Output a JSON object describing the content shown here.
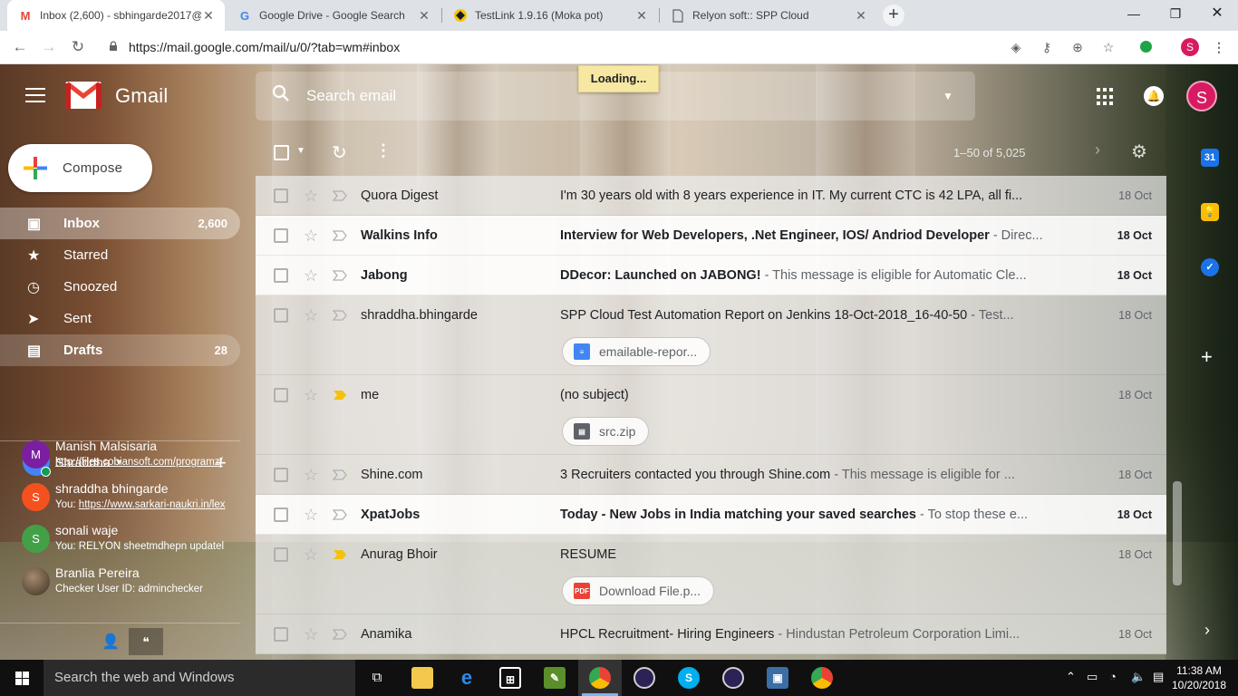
{
  "browser": {
    "tabs": [
      {
        "title": "Inbox (2,600) - sbhingarde2017@",
        "active": true,
        "icon": "gmail-icon"
      },
      {
        "title": "Google Drive - Google Search",
        "active": false,
        "icon": "google-icon"
      },
      {
        "title": "TestLink 1.9.16 (Moka pot)",
        "active": false,
        "icon": "testlink-icon"
      },
      {
        "title": "Relyon soft:: SPP Cloud",
        "active": false,
        "icon": "page-icon"
      }
    ],
    "url": "https://mail.google.com/mail/u/0/?tab=wm#inbox",
    "profile_initial": "S"
  },
  "gmail": {
    "app_name": "Gmail",
    "search_placeholder": "Search email",
    "loading_text": "Loading...",
    "account_initial": "S",
    "compose_label": "Compose",
    "nav": [
      {
        "label": "Inbox",
        "count": "2,600",
        "icon": "inbox-icon",
        "state": "active"
      },
      {
        "label": "Starred",
        "count": "",
        "icon": "star-icon",
        "state": "normal"
      },
      {
        "label": "Snoozed",
        "count": "",
        "icon": "clock-icon",
        "state": "normal"
      },
      {
        "label": "Sent",
        "count": "",
        "icon": "send-icon",
        "state": "normal"
      },
      {
        "label": "Drafts",
        "count": "28",
        "icon": "draft-icon",
        "state": "drafts"
      }
    ],
    "hangouts": {
      "user": "Shraddha",
      "contacts": [
        {
          "name": "Manish Malsisaria",
          "sub": "http://files.cobiansoft.com/programz/",
          "sub_prefix": "",
          "initial": "M",
          "color": "#7b1fa2"
        },
        {
          "name": "shraddha bhingarde",
          "sub": "https://www.sarkari-naukri.in/lex",
          "sub_prefix": "You: ",
          "initial": "S",
          "color": "#f4511e"
        },
        {
          "name": "sonali waje",
          "sub": "RELYON sheetmdhepn updatel",
          "sub_prefix": "You: ",
          "initial": "S",
          "color": "#43a047"
        },
        {
          "name": "Branlia Pereira",
          "sub": "Checker User ID: adminchecker",
          "sub_prefix": "",
          "initial": "",
          "color": "#5d4a3a"
        }
      ]
    },
    "list_toolbar": {
      "range": "1–50 of 5,025"
    },
    "emails": [
      {
        "sender": "Quora Digest",
        "subject": "I'm 30 years old with 8 years experience in IT. My current CTC is 42 LPA, all fi...",
        "snippet": "",
        "date": "18 Oct",
        "unread": false,
        "important": false,
        "attachment": ""
      },
      {
        "sender": "Walkins Info",
        "subject": "Interview for Web Developers, .Net Engineer, IOS/ Andriod Developer",
        "snippet": " - Direc...",
        "date": "18 Oct",
        "unread": true,
        "important": false,
        "attachment": ""
      },
      {
        "sender": "Jabong",
        "subject": "DDecor: Launched on JABONG!",
        "snippet": " - This message is eligible for Automatic Cle...",
        "date": "18 Oct",
        "unread": true,
        "important": false,
        "attachment": ""
      },
      {
        "sender": "shraddha.bhingarde",
        "subject": "SPP Cloud Test Automation Report on Jenkins 18-Oct-2018_16-40-50",
        "snippet": " - Test...",
        "date": "18 Oct",
        "unread": false,
        "important": false,
        "attachment": "emailable-repor...",
        "attachment_type": "doc"
      },
      {
        "sender": "me",
        "subject": "(no subject)",
        "snippet": "",
        "date": "18 Oct",
        "unread": false,
        "important": true,
        "attachment": "src.zip",
        "attachment_type": "zip"
      },
      {
        "sender": "Shine.com",
        "subject": "3 Recruiters contacted you through Shine.com",
        "snippet": " - This message is eligible for ...",
        "date": "18 Oct",
        "unread": false,
        "important": false,
        "attachment": ""
      },
      {
        "sender": "XpatJobs",
        "subject": "Today - New Jobs in India matching your saved searches",
        "snippet": " - To stop these e...",
        "date": "18 Oct",
        "unread": true,
        "important": false,
        "attachment": ""
      },
      {
        "sender": "Anurag Bhoir",
        "subject": "RESUME",
        "snippet": "",
        "date": "18 Oct",
        "unread": false,
        "important": true,
        "attachment": "Download File.p...",
        "attachment_type": "pdf"
      },
      {
        "sender": "Anamika",
        "subject": "HPCL Recruitment- Hiring Engineers",
        "snippet": " - Hindustan Petroleum Corporation Limi...",
        "date": "18 Oct",
        "unread": false,
        "important": false,
        "attachment": ""
      }
    ],
    "side_panel": {
      "calendar_day": "31"
    }
  },
  "taskbar": {
    "search_text": "Search the web and Windows",
    "time": "11:38 AM",
    "date": "10/20/2018"
  },
  "colors": {
    "gmail_red": "#ea4335",
    "accent_pink": "#d81b60",
    "important_yellow": "#f4c20d"
  }
}
